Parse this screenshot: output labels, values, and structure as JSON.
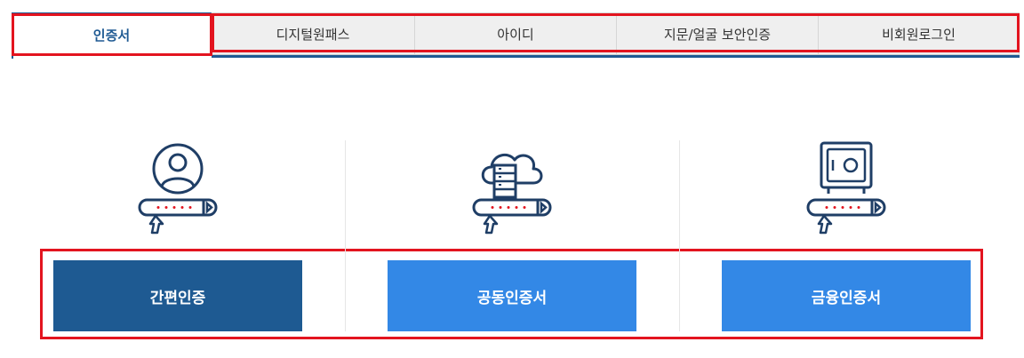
{
  "tabs": [
    {
      "label": "인증서",
      "active": true
    },
    {
      "label": "디지털원패스",
      "active": false
    },
    {
      "label": "아이디",
      "active": false
    },
    {
      "label": "지문/얼굴 보안인증",
      "active": false
    },
    {
      "label": "비회원로그인",
      "active": false
    }
  ],
  "options": [
    {
      "label": "간편인증",
      "icon": "user-circle-icon",
      "color": "#1e5a92"
    },
    {
      "label": "공동인증서",
      "icon": "cloud-server-icon",
      "color": "#3388e6"
    },
    {
      "label": "금융인증서",
      "icon": "safe-icon",
      "color": "#3388e6"
    }
  ],
  "colors": {
    "accent": "#1f5a93",
    "highlight": "#e3141f",
    "icon_dots": "#e3141f"
  }
}
